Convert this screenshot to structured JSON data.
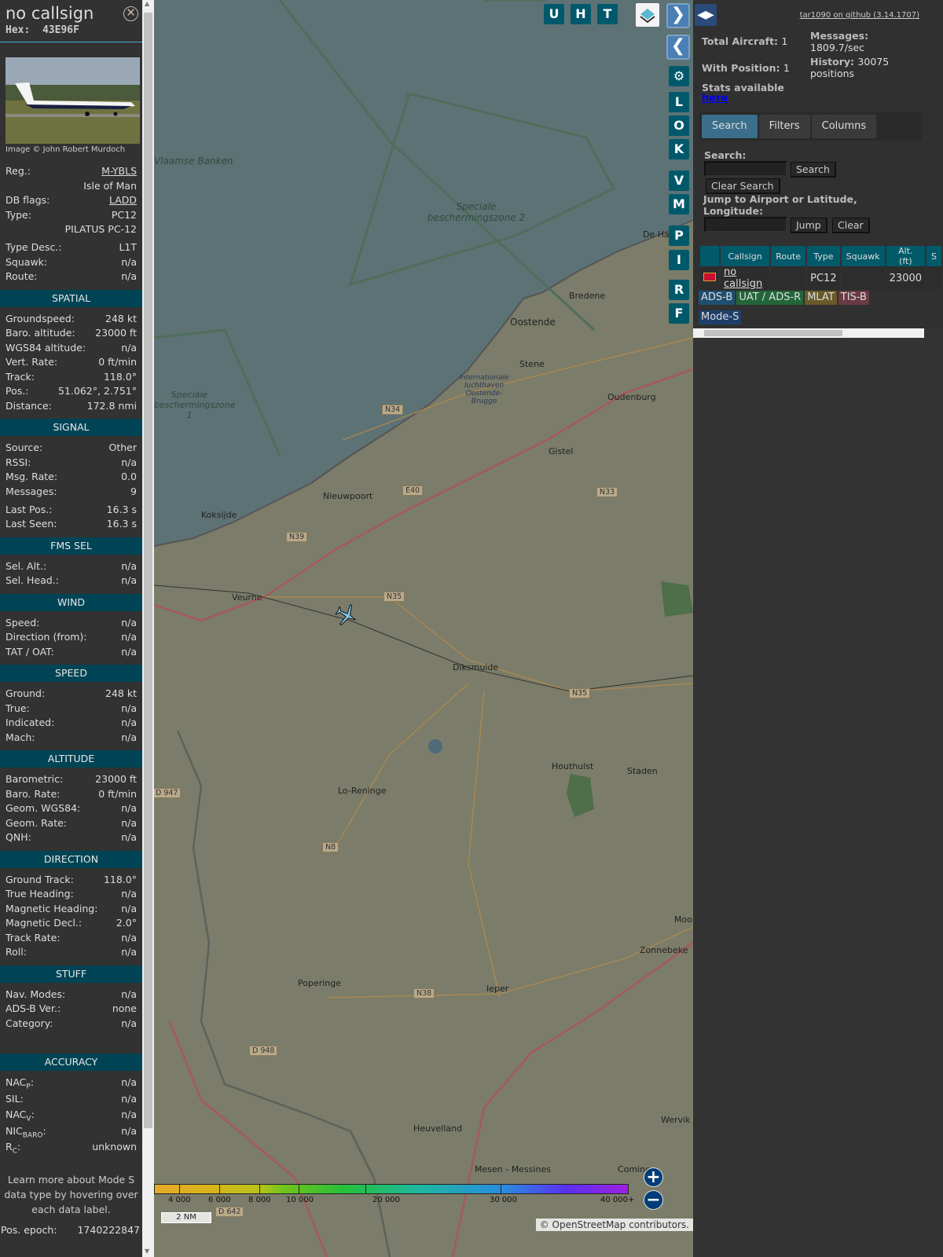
{
  "aircraft": {
    "callsign": "no callsign",
    "hex_label": "Hex:",
    "hex": "43E96F",
    "photo_credit": "Image © John Robert Murdoch"
  },
  "info": [
    {
      "label": "Reg.:",
      "value": "M-YBLS",
      "link": true
    },
    {
      "label": "",
      "value": "Isle of Man"
    },
    {
      "label": "DB flags:",
      "value": "LADD",
      "link": true
    },
    {
      "label": "Type:",
      "value": "PC12"
    },
    {
      "label": "",
      "value": "PILATUS PC-12"
    },
    {
      "gap": true
    },
    {
      "label": "Type Desc.:",
      "value": "L1T"
    },
    {
      "label": "Squawk:",
      "value": "n/a"
    },
    {
      "label": "Route:",
      "value": "n/a"
    }
  ],
  "sections": [
    {
      "title": "SPATIAL",
      "rows": [
        {
          "label": "Groundspeed:",
          "value": "248 kt"
        },
        {
          "label": "Baro. altitude:",
          "value": "23000 ft"
        },
        {
          "label": "WGS84 altitude:",
          "value": "n/a"
        },
        {
          "label": "Vert. Rate:",
          "value": "0 ft/min"
        },
        {
          "label": "Track:",
          "value": "118.0°"
        },
        {
          "label": "Pos.:",
          "value": "51.062°, 2.751°"
        },
        {
          "label": "Distance:",
          "value": "172.8 nmi"
        }
      ]
    },
    {
      "title": "SIGNAL",
      "rows": [
        {
          "label": "Source:",
          "value": "Other"
        },
        {
          "label": "RSSI:",
          "value": "n/a"
        },
        {
          "label": "Msg. Rate:",
          "value": "0.0"
        },
        {
          "label": "Messages:",
          "value": "9"
        },
        {
          "gap": true
        },
        {
          "label": "Last Pos.:",
          "value": "16.3 s"
        },
        {
          "label": "Last Seen:",
          "value": "16.3 s"
        }
      ]
    },
    {
      "title": "FMS SEL",
      "rows": [
        {
          "label": "Sel. Alt.:",
          "value": "n/a"
        },
        {
          "label": "Sel. Head.:",
          "value": "n/a"
        }
      ]
    },
    {
      "title": "WIND",
      "rows": [
        {
          "label": "Speed:",
          "value": "n/a"
        },
        {
          "label": "Direction (from):",
          "value": "n/a"
        },
        {
          "label": "TAT / OAT:",
          "value": "n/a"
        }
      ]
    },
    {
      "title": "SPEED",
      "rows": [
        {
          "label": "Ground:",
          "value": "248 kt"
        },
        {
          "label": "True:",
          "value": "n/a"
        },
        {
          "label": "Indicated:",
          "value": "n/a"
        },
        {
          "label": "Mach:",
          "value": "n/a"
        }
      ]
    },
    {
      "title": "ALTITUDE",
      "rows": [
        {
          "label": "Barometric:",
          "value": "23000 ft"
        },
        {
          "label": "Baro. Rate:",
          "value": "0 ft/min"
        },
        {
          "label": "Geom. WGS84:",
          "value": "n/a"
        },
        {
          "label": "Geom. Rate:",
          "value": "n/a"
        },
        {
          "label": "QNH:",
          "value": "n/a"
        }
      ]
    },
    {
      "title": "DIRECTION",
      "rows": [
        {
          "label": "Ground Track:",
          "value": "118.0°"
        },
        {
          "label": "True Heading:",
          "value": "n/a"
        },
        {
          "label": "Magnetic Heading:",
          "value": "n/a"
        },
        {
          "label": "Magnetic Decl.:",
          "value": "2.0°"
        },
        {
          "label": "Track Rate:",
          "value": "n/a"
        },
        {
          "label": "Roll:",
          "value": "n/a"
        }
      ]
    },
    {
      "title": "STUFF",
      "rows": [
        {
          "label": "Nav. Modes:",
          "value": "n/a"
        },
        {
          "label": "ADS-B Ver.:",
          "value": "none"
        },
        {
          "label": "Category:",
          "value": "n/a"
        }
      ]
    }
  ],
  "accuracy": {
    "title": "ACCURACY",
    "rows": [
      {
        "label": "NAC",
        "sub": "P",
        "value": "n/a"
      },
      {
        "label": "SIL:",
        "sub": "",
        "value": "n/a"
      },
      {
        "label": "NAC",
        "sub": "V",
        "value": "n/a"
      },
      {
        "label": "NIC",
        "sub": "BARO",
        "value": "n/a"
      },
      {
        "label": "R",
        "sub": "C",
        "value": "unknown"
      }
    ]
  },
  "note": "Learn more about Mode S data type by hovering over each data label.",
  "pos_epoch": {
    "label": "Pos. epoch:",
    "value": "1740222847"
  },
  "map": {
    "top_buttons": [
      "U",
      "H",
      "T"
    ],
    "side_buttons": [
      "L",
      "O",
      "K",
      "V",
      "M",
      "P",
      "I",
      "R",
      "F"
    ],
    "labels": [
      "Vlaamse Banken",
      "Speciale beschermingszone 2",
      "Speciale beschermingszone 1",
      "De Ha",
      "Bredene",
      "Oostende",
      "Stene",
      "Internationale luchthaven Oostende-Brugge",
      "Oudenburg",
      "Gistel",
      "Nieuwpoort",
      "Koksijde",
      "Veurne",
      "Diksmuide",
      "Houthulst",
      "Staden",
      "Lo-Reninge",
      "Poperinge",
      "Ieper",
      "Zonnebeke",
      "Heuvelland",
      "Mesen - Messines",
      "Comines",
      "Wervik",
      "Moo"
    ],
    "roads": [
      "N34",
      "E40",
      "N33",
      "N39",
      "N35",
      "N35",
      "N8",
      "N38",
      "D 947",
      "D 948",
      "D 642"
    ],
    "color_scale": [
      "4 000",
      "6 000",
      "8 000",
      "10 000",
      "20 000",
      "30 000",
      "40 000+"
    ],
    "scale_label": "2 NM",
    "attribution_prefix": "© ",
    "attribution_link": "OpenStreetMap",
    "attribution_suffix": " contributors."
  },
  "right": {
    "github": "tar1090 on github (3.14.1707)",
    "total_label": "Total Aircraft:",
    "total": "1",
    "withpos_label": "With Position:",
    "withpos": "1",
    "messages_label": "Messages:",
    "messages": "1809.7/sec",
    "history_label": "History:",
    "history": "30075 positions",
    "stats_label": "Stats available",
    "stats_link": "here",
    "tabs": [
      "Search",
      "Filters",
      "Columns"
    ],
    "search_label": "Search:",
    "search_btn": "Search",
    "clear_search_btn": "Clear Search",
    "jump_label": "Jump to Airport or Latitude, Longitude:",
    "jump_btn": "Jump",
    "clear_btn": "Clear",
    "columns": [
      "",
      "Callsign",
      "Route",
      "Type",
      "Squawk",
      "Alt. (ft)",
      "S"
    ],
    "rows": [
      {
        "callsign": "no callsign",
        "route": "",
        "type": "PC12",
        "squawk": "",
        "alt": "23000"
      }
    ],
    "sources": [
      {
        "label": "ADS-B",
        "color": "#1f4f70"
      },
      {
        "label": "UAT / ADS-R",
        "color": "#22663a"
      },
      {
        "label": "MLAT",
        "color": "#6a5a2a"
      },
      {
        "label": "TIS-B",
        "color": "#6a3a44"
      },
      {
        "label": "Mode-S",
        "color": "#1f3f6a"
      }
    ]
  }
}
